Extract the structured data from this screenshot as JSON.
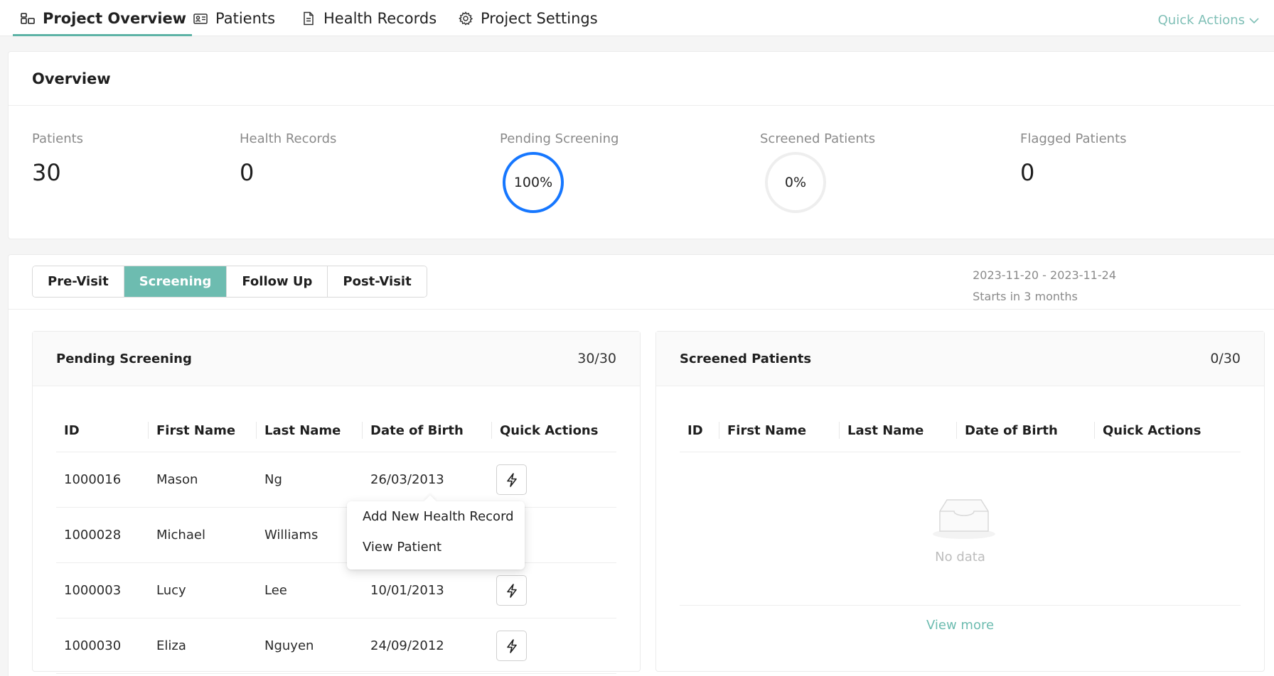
{
  "nav": {
    "tabs": [
      {
        "label": "Project Overview",
        "icon": "dashboard-icon",
        "active": true
      },
      {
        "label": "Patients",
        "icon": "id-card-icon",
        "active": false
      },
      {
        "label": "Health Records",
        "icon": "document-icon",
        "active": false
      },
      {
        "label": "Project Settings",
        "icon": "gear-icon",
        "active": false
      }
    ],
    "quick_actions": "Quick Actions"
  },
  "overview": {
    "title": "Overview",
    "stats": {
      "patients": {
        "label": "Patients",
        "value": "30"
      },
      "health_records": {
        "label": "Health Records",
        "value": "0"
      },
      "pending_screening": {
        "label": "Pending Screening",
        "percent_label": "100%",
        "percent": 100
      },
      "screened_patients": {
        "label": "Screened Patients",
        "percent_label": "0%",
        "percent": 0
      },
      "flagged_patients": {
        "label": "Flagged Patients",
        "value": "0"
      }
    }
  },
  "stages": {
    "items": [
      "Pre-Visit",
      "Screening",
      "Follow Up",
      "Post-Visit"
    ],
    "active": "Screening",
    "date_range": "2023-11-20 - 2023-11-24",
    "starts_in": "Starts in 3 months"
  },
  "pending_panel": {
    "title": "Pending Screening",
    "count": "30/30",
    "columns": [
      "ID",
      "First Name",
      "Last Name",
      "Date of Birth",
      "Quick Actions"
    ],
    "rows": [
      {
        "id": "1000016",
        "first": "Mason",
        "last": "Ng",
        "dob": "26/03/2013"
      },
      {
        "id": "1000028",
        "first": "Michael",
        "last": "Williams",
        "dob": ""
      },
      {
        "id": "1000003",
        "first": "Lucy",
        "last": "Lee",
        "dob": "10/01/2013"
      },
      {
        "id": "1000030",
        "first": "Eliza",
        "last": "Nguyen",
        "dob": "24/09/2012"
      }
    ],
    "dropdown": {
      "items": [
        "Add New Health Record",
        "View Patient"
      ]
    }
  },
  "screened_panel": {
    "title": "Screened Patients",
    "count": "0/30",
    "columns": [
      "ID",
      "First Name",
      "Last Name",
      "Date of Birth",
      "Quick Actions"
    ],
    "empty_text": "No data",
    "view_more": "View more"
  },
  "colors": {
    "accent": "#6dbcb0",
    "ring_active": "#1677ff",
    "ring_track": "#eeeeee"
  }
}
